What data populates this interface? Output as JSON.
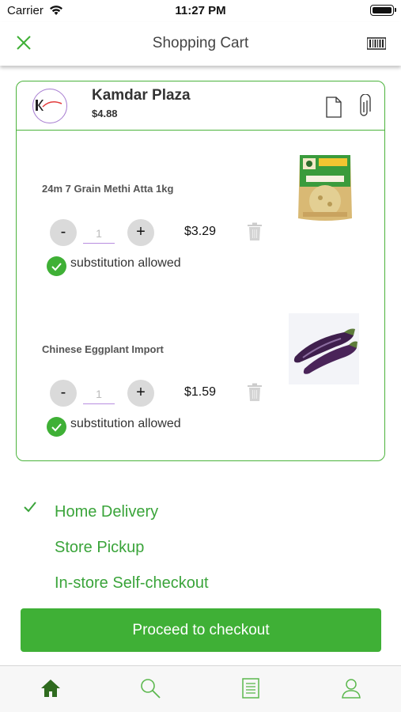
{
  "status_bar": {
    "carrier": "Carrier",
    "time": "11:27 PM"
  },
  "nav": {
    "title": "Shopping Cart"
  },
  "store": {
    "name": "Kamdar Plaza",
    "total": "$4.88",
    "logo_text": "Kamdar"
  },
  "items": [
    {
      "name": "24m 7 Grain Methi Atta 1kg",
      "quantity": "1",
      "price": "$3.29",
      "substitution_label": "substitution allowed",
      "substitution_allowed": true,
      "decrement": "-",
      "increment": "+"
    },
    {
      "name": "Chinese Eggplant Import",
      "quantity": "1",
      "price": "$1.59",
      "substitution_label": "substitution allowed",
      "substitution_allowed": true,
      "decrement": "-",
      "increment": "+"
    }
  ],
  "delivery_options": [
    {
      "label": "Home Delivery",
      "selected": true
    },
    {
      "label": "Store Pickup",
      "selected": false
    },
    {
      "label": "In-store Self-checkout",
      "selected": false
    }
  ],
  "checkout": {
    "label": "Proceed to checkout"
  },
  "tabs": [
    "home-icon",
    "search-icon",
    "orders-icon",
    "profile-icon"
  ],
  "colors": {
    "accent": "#3fb036",
    "accent_text": "#3aa43a",
    "tab_active": "#2f6b1f",
    "tab_inactive": "#5cb84e"
  }
}
